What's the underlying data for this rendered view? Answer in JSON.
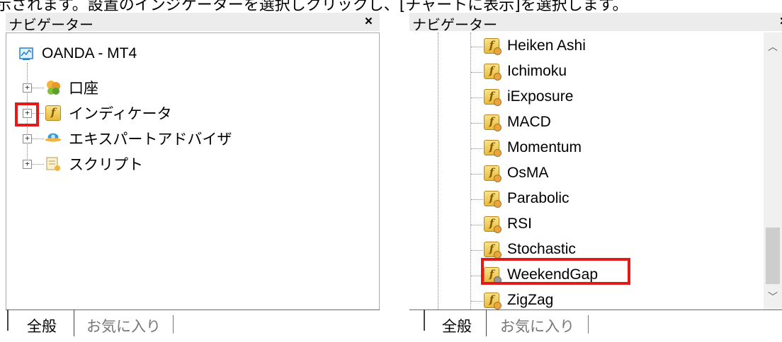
{
  "caption": {
    "left": "示されます。設置のインジケーターを選択しクリックし、[チャートに表示]を選択します。"
  },
  "left_panel": {
    "title": "ナビゲーター",
    "close": "×",
    "root": "OANDA - MT4",
    "items": [
      {
        "label": "口座",
        "icon": "accounts-icon"
      },
      {
        "label": "インディケータ",
        "icon": "indicator-icon"
      },
      {
        "label": "エキスパートアドバイザ",
        "icon": "expert-advisor-icon"
      },
      {
        "label": "スクリプト",
        "icon": "script-icon"
      }
    ],
    "tabs": [
      "全般",
      "お気に入り"
    ]
  },
  "right_panel": {
    "title": "ナビゲーター",
    "close": "×",
    "items": [
      "Heiken Ashi",
      "Ichimoku",
      "iExposure",
      "MACD",
      "Momentum",
      "OsMA",
      "Parabolic",
      "RSI",
      "Stochastic",
      "WeekendGap",
      "ZigZag"
    ],
    "highlighted": "WeekendGap",
    "tabs": [
      "全般",
      "お気に入り"
    ]
  },
  "colors": {
    "highlight": "#e31a1a",
    "indicator_icon": "#e8b93a"
  }
}
